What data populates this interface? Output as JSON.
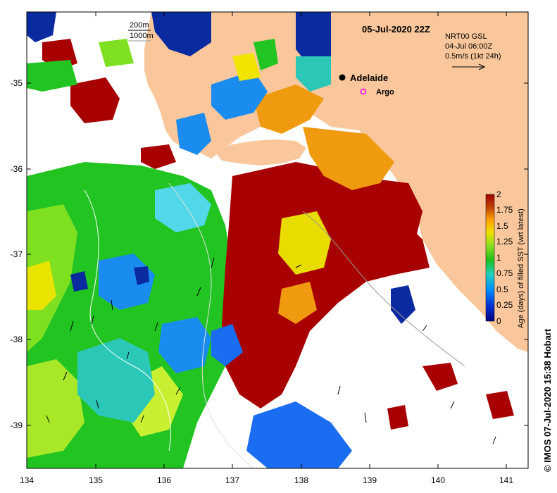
{
  "title": "05-Jul-2020 22Z",
  "depth_legend": {
    "contour_1": "200m",
    "contour_2": "1000m"
  },
  "current_info": {
    "line1": "NRT00 GSL",
    "line2": "04-Jul 06:00Z",
    "line3": "0.5m/s (1kt 24h)"
  },
  "places": {
    "city": "Adelaide",
    "float_label": "Argo"
  },
  "axes": {
    "x_ticks": [
      "134",
      "135",
      "136",
      "137",
      "138",
      "139",
      "140",
      "141"
    ],
    "y_ticks": [
      "-35",
      "-36",
      "-37",
      "-38",
      "-39"
    ],
    "lon_range": [
      134,
      141.35
    ],
    "lat_range": [
      -39.45,
      -34.2
    ]
  },
  "colorbar": {
    "label": "Age (days) of filled SST (wrt latest)",
    "ticks": [
      "2",
      "1.75",
      "1.5",
      "1.25",
      "1",
      "0.75",
      "0.5",
      "0.25",
      "0"
    ],
    "colors": [
      "#000080",
      "#0050e0",
      "#00a8ff",
      "#20d0c0",
      "#20c020",
      "#80e020",
      "#e8e000",
      "#ffa000",
      "#c04000",
      "#a00000"
    ]
  },
  "credit": "© IMOS 07-Jul-2020 15:38 Hobart",
  "colors": {
    "land": "#f9c79b",
    "frame": "#000000",
    "city_marker": "#000000",
    "argo_marker": "#ff00ff"
  }
}
